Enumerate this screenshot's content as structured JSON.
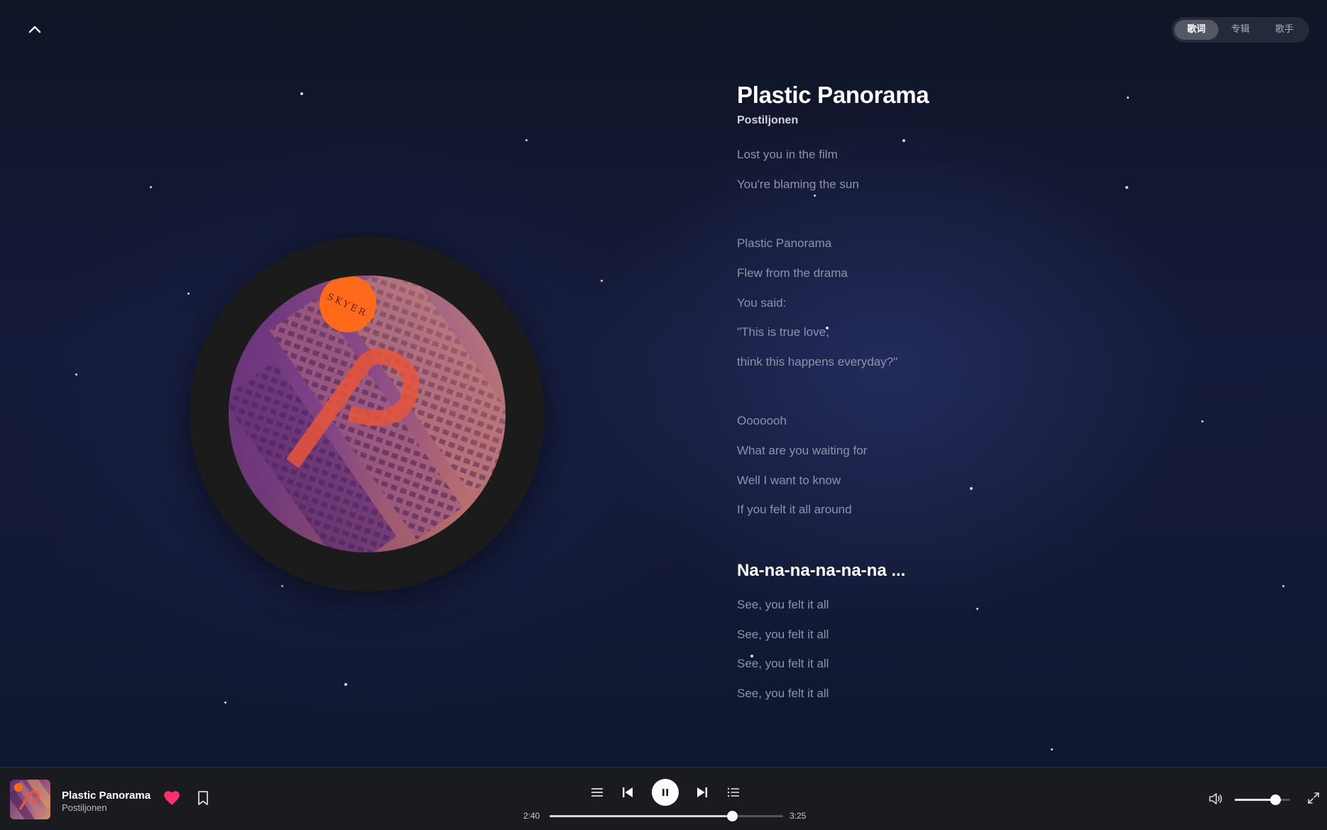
{
  "header": {
    "collapse_icon": "chevron-up-icon",
    "tabs": [
      {
        "label": "歌词",
        "active": true
      },
      {
        "label": "专辑",
        "active": false
      },
      {
        "label": "歌手",
        "active": false
      }
    ]
  },
  "song": {
    "title": "Plastic Panorama",
    "artist": "Postiljonen",
    "cover_text": "SKYER"
  },
  "lyrics": {
    "lines": [
      {
        "text": "Lost you in the film"
      },
      {
        "text": "You're blaming the sun"
      },
      {
        "text": "Plastic Panorama"
      },
      {
        "text": "Flew from the drama"
      },
      {
        "text": "You said:"
      },
      {
        "text": "\"This is true love,"
      },
      {
        "text": "think this happens everyday?\""
      },
      {
        "text": "Ooooooh"
      },
      {
        "text": "What are you waiting for"
      },
      {
        "text": "Well I want to know"
      },
      {
        "text": "If you felt it all around"
      },
      {
        "text": "Na-na-na-na-na-na ..."
      },
      {
        "text": "See, you felt it all"
      },
      {
        "text": "See, you felt it all"
      },
      {
        "text": "See, you felt it all"
      },
      {
        "text": "See, you felt it all"
      }
    ],
    "current_line": "Na-na-na-na-na-na ..."
  },
  "player": {
    "title": "Plastic Panorama",
    "artist": "Postiljonen",
    "liked": true,
    "time_current": "2:40",
    "time_total": "3:25",
    "progress": 0.78,
    "volume": 0.73,
    "icons": {
      "like": "heart-icon",
      "bookmark": "bookmark-icon",
      "mode": "list-icon",
      "prev": "skip-previous-icon",
      "play": "pause-icon",
      "next": "skip-next-icon",
      "queue": "queue-icon",
      "volume": "volume-icon",
      "fullscreen": "fullscreen-icon"
    }
  },
  "colors": {
    "accent_heart": "#ff2e6d",
    "cover_orange": "#ff6a1a",
    "background": "#131a36",
    "player_bar": "#1a1b1f"
  }
}
